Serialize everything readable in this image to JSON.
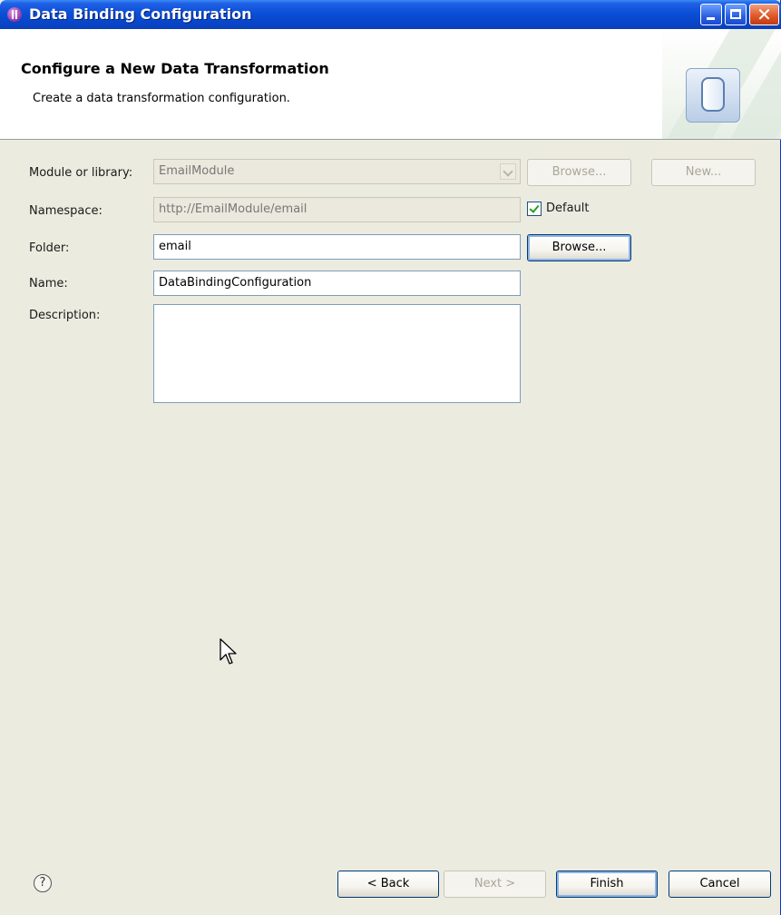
{
  "window": {
    "title": "Data Binding Configuration"
  },
  "header": {
    "title": "Configure a New Data Transformation",
    "description": "Create a data transformation configuration."
  },
  "form": {
    "module_label": "Module or library:",
    "module_value": "EmailModule",
    "module_browse": "Browse...",
    "module_new": "New...",
    "namespace_label": "Namespace:",
    "namespace_value": "http://EmailModule/email",
    "default_label": "Default",
    "default_checked": true,
    "folder_label": "Folder:",
    "folder_value": "email",
    "folder_browse": "Browse...",
    "name_label": "Name:",
    "name_value": "DataBindingConfiguration",
    "description_label": "Description:",
    "description_value": ""
  },
  "footer": {
    "help_icon": "help-icon",
    "back": "< Back",
    "next": "Next >",
    "finish": "Finish",
    "cancel": "Cancel"
  },
  "colors": {
    "titlebar": "#0845c8",
    "dialog_bg": "#ecebe0",
    "check": "#21a121"
  }
}
